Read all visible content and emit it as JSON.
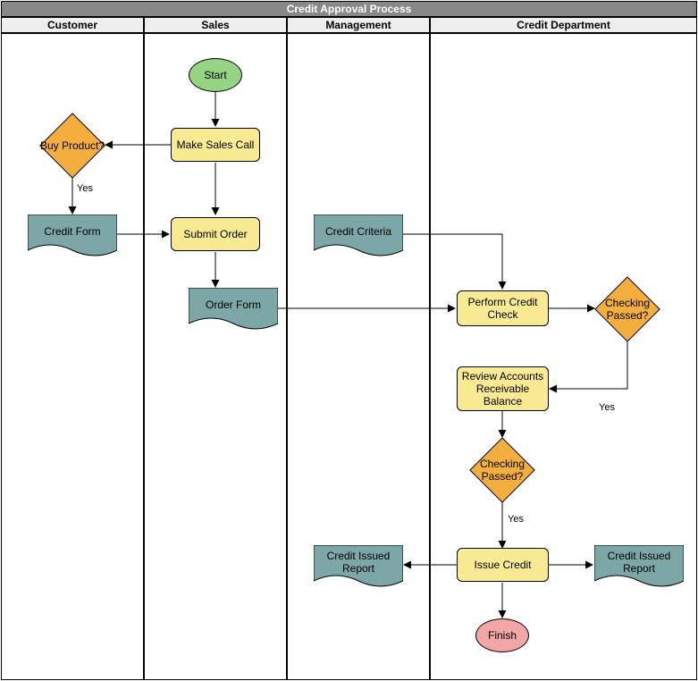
{
  "title": "Credit Approval Process",
  "lanes": {
    "customer": "Customer",
    "sales": "Sales",
    "management": "Management",
    "credit": "Credit Department"
  },
  "nodes": {
    "start": "Start",
    "makeCall": "Make Sales Call",
    "buyProduct": "Buy Product?",
    "creditForm": "Credit Form",
    "submitOrder": "Submit Order",
    "orderForm": "Order Form",
    "creditCriteria": "Credit Criteria",
    "performCheck": "Perform Credit Check",
    "checkPassed1": "Checking Passed?",
    "reviewAR": "Review Accounts Receivable Balance",
    "checkPassed2": "Checking Passed?",
    "issueCredit": "Issue Credit",
    "reportMgmt": "Credit Issued Report",
    "reportCredit": "Credit Issued Report",
    "finish": "Finish"
  },
  "edgeLabels": {
    "yes1": "Yes",
    "yes2": "Yes",
    "yes3": "Yes"
  }
}
